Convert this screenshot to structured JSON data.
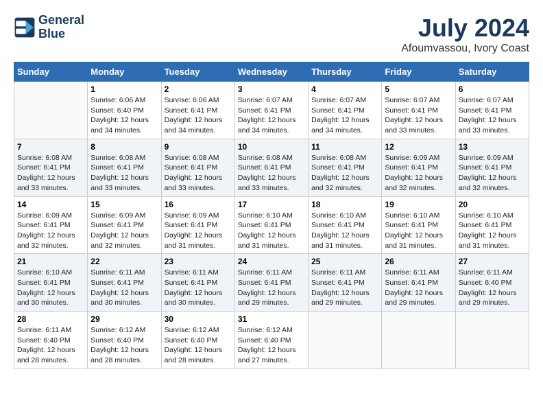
{
  "header": {
    "logo_line1": "General",
    "logo_line2": "Blue",
    "month_year": "July 2024",
    "location": "Afoumvassou, Ivory Coast"
  },
  "weekdays": [
    "Sunday",
    "Monday",
    "Tuesday",
    "Wednesday",
    "Thursday",
    "Friday",
    "Saturday"
  ],
  "weeks": [
    [
      {
        "day": "",
        "empty": true
      },
      {
        "day": "1",
        "sunrise": "6:06 AM",
        "sunset": "6:40 PM",
        "daylight": "12 hours and 34 minutes."
      },
      {
        "day": "2",
        "sunrise": "6:06 AM",
        "sunset": "6:41 PM",
        "daylight": "12 hours and 34 minutes."
      },
      {
        "day": "3",
        "sunrise": "6:07 AM",
        "sunset": "6:41 PM",
        "daylight": "12 hours and 34 minutes."
      },
      {
        "day": "4",
        "sunrise": "6:07 AM",
        "sunset": "6:41 PM",
        "daylight": "12 hours and 34 minutes."
      },
      {
        "day": "5",
        "sunrise": "6:07 AM",
        "sunset": "6:41 PM",
        "daylight": "12 hours and 33 minutes."
      },
      {
        "day": "6",
        "sunrise": "6:07 AM",
        "sunset": "6:41 PM",
        "daylight": "12 hours and 33 minutes."
      }
    ],
    [
      {
        "day": "7",
        "sunrise": "6:08 AM",
        "sunset": "6:41 PM",
        "daylight": "12 hours and 33 minutes."
      },
      {
        "day": "8",
        "sunrise": "6:08 AM",
        "sunset": "6:41 PM",
        "daylight": "12 hours and 33 minutes."
      },
      {
        "day": "9",
        "sunrise": "6:08 AM",
        "sunset": "6:41 PM",
        "daylight": "12 hours and 33 minutes."
      },
      {
        "day": "10",
        "sunrise": "6:08 AM",
        "sunset": "6:41 PM",
        "daylight": "12 hours and 33 minutes."
      },
      {
        "day": "11",
        "sunrise": "6:08 AM",
        "sunset": "6:41 PM",
        "daylight": "12 hours and 32 minutes."
      },
      {
        "day": "12",
        "sunrise": "6:09 AM",
        "sunset": "6:41 PM",
        "daylight": "12 hours and 32 minutes."
      },
      {
        "day": "13",
        "sunrise": "6:09 AM",
        "sunset": "6:41 PM",
        "daylight": "12 hours and 32 minutes."
      }
    ],
    [
      {
        "day": "14",
        "sunrise": "6:09 AM",
        "sunset": "6:41 PM",
        "daylight": "12 hours and 32 minutes."
      },
      {
        "day": "15",
        "sunrise": "6:09 AM",
        "sunset": "6:41 PM",
        "daylight": "12 hours and 32 minutes."
      },
      {
        "day": "16",
        "sunrise": "6:09 AM",
        "sunset": "6:41 PM",
        "daylight": "12 hours and 31 minutes."
      },
      {
        "day": "17",
        "sunrise": "6:10 AM",
        "sunset": "6:41 PM",
        "daylight": "12 hours and 31 minutes."
      },
      {
        "day": "18",
        "sunrise": "6:10 AM",
        "sunset": "6:41 PM",
        "daylight": "12 hours and 31 minutes."
      },
      {
        "day": "19",
        "sunrise": "6:10 AM",
        "sunset": "6:41 PM",
        "daylight": "12 hours and 31 minutes."
      },
      {
        "day": "20",
        "sunrise": "6:10 AM",
        "sunset": "6:41 PM",
        "daylight": "12 hours and 31 minutes."
      }
    ],
    [
      {
        "day": "21",
        "sunrise": "6:10 AM",
        "sunset": "6:41 PM",
        "daylight": "12 hours and 30 minutes."
      },
      {
        "day": "22",
        "sunrise": "6:11 AM",
        "sunset": "6:41 PM",
        "daylight": "12 hours and 30 minutes."
      },
      {
        "day": "23",
        "sunrise": "6:11 AM",
        "sunset": "6:41 PM",
        "daylight": "12 hours and 30 minutes."
      },
      {
        "day": "24",
        "sunrise": "6:11 AM",
        "sunset": "6:41 PM",
        "daylight": "12 hours and 29 minutes."
      },
      {
        "day": "25",
        "sunrise": "6:11 AM",
        "sunset": "6:41 PM",
        "daylight": "12 hours and 29 minutes."
      },
      {
        "day": "26",
        "sunrise": "6:11 AM",
        "sunset": "6:41 PM",
        "daylight": "12 hours and 29 minutes."
      },
      {
        "day": "27",
        "sunrise": "6:11 AM",
        "sunset": "6:40 PM",
        "daylight": "12 hours and 29 minutes."
      }
    ],
    [
      {
        "day": "28",
        "sunrise": "6:11 AM",
        "sunset": "6:40 PM",
        "daylight": "12 hours and 28 minutes."
      },
      {
        "day": "29",
        "sunrise": "6:12 AM",
        "sunset": "6:40 PM",
        "daylight": "12 hours and 28 minutes."
      },
      {
        "day": "30",
        "sunrise": "6:12 AM",
        "sunset": "6:40 PM",
        "daylight": "12 hours and 28 minutes."
      },
      {
        "day": "31",
        "sunrise": "6:12 AM",
        "sunset": "6:40 PM",
        "daylight": "12 hours and 27 minutes."
      },
      {
        "day": "",
        "empty": true
      },
      {
        "day": "",
        "empty": true
      },
      {
        "day": "",
        "empty": true
      }
    ]
  ]
}
